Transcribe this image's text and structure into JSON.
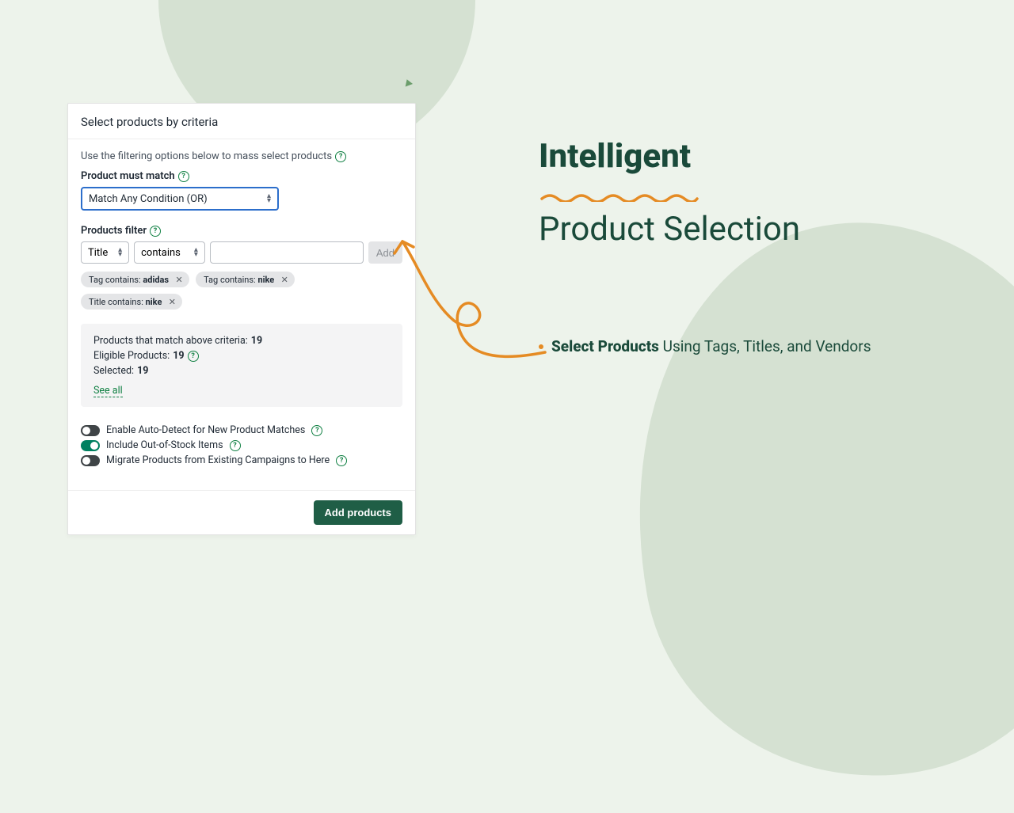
{
  "card": {
    "title": "Select products by criteria",
    "intro": "Use the filtering options below to mass select products",
    "match_label": "Product must match",
    "match_value": "Match Any Condition (OR)",
    "filter_label": "Products filter",
    "filter_field": "Title",
    "filter_op": "contains",
    "filter_value": "",
    "add": "Add",
    "chips": [
      {
        "prefix": "Tag contains: ",
        "value": "adidas"
      },
      {
        "prefix": "Tag contains: ",
        "value": "nike"
      },
      {
        "prefix": "Title contains: ",
        "value": "nike"
      }
    ],
    "stats": {
      "match_label": "Products that match above criteria: ",
      "match_value": "19",
      "eligible_label": "Eligible Products: ",
      "eligible_value": "19",
      "selected_label": "Selected: ",
      "selected_value": "19",
      "see_all": "See all"
    },
    "toggles": {
      "auto_detect": "Enable Auto-Detect for New Product Matches",
      "oos": "Include Out-of-Stock Items",
      "migrate": "Migrate Products from Existing Campaigns to Here"
    },
    "add_products": "Add products"
  },
  "right": {
    "h1_bold": "Intelligent",
    "h1_light": "Product Selection",
    "bullet_bold": "Select Products",
    "bullet_rest": " Using Tags, Titles, and Vendors"
  }
}
